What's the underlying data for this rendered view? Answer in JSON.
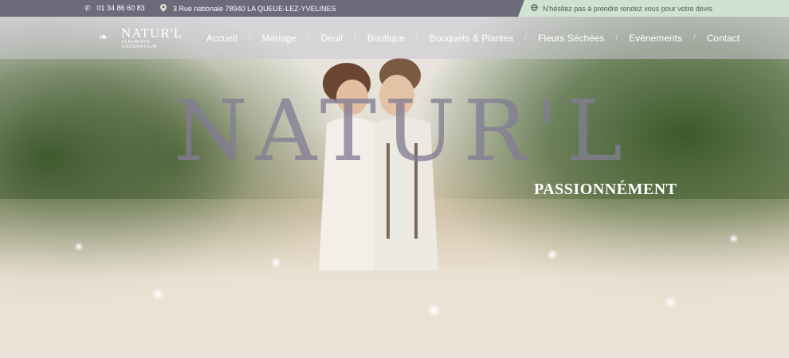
{
  "topbar": {
    "phone_icon": "phone-icon",
    "phone": "01 34 86 60 83",
    "address_icon": "map-pin-icon",
    "address": "3 Rue nationale 78940 LA QUEUE-LEZ-YVELINES",
    "cta_icon": "globe-icon",
    "cta": "N'hésitez pas à prendre rendez vous pour votre devis"
  },
  "logo": {
    "name": "NATUR'L",
    "subtitle": "FLEURISTE DÉCORATEUR"
  },
  "nav": {
    "items": [
      {
        "label": "Accueil"
      },
      {
        "label": "Mariage"
      },
      {
        "label": "Deuil"
      },
      {
        "label": "Boutique"
      },
      {
        "label": "Bouquets & Plantes"
      },
      {
        "label": "Fleurs Séchées"
      },
      {
        "label": "Evènements"
      },
      {
        "label": "Contact"
      }
    ]
  },
  "hero": {
    "brand": "NATUR'L",
    "tagline": "PASSIONNÉMENT"
  },
  "colors": {
    "topbar": "#6d6a7c",
    "cta_background": "#cfe4d0",
    "brand_text": "#837c94"
  }
}
